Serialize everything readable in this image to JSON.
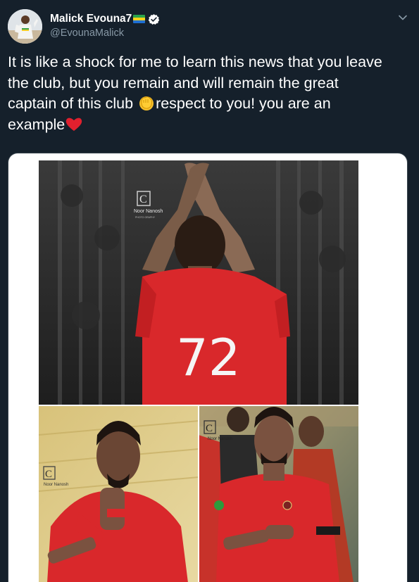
{
  "user": {
    "display_name": "Malick Evouna7",
    "handle": "@EvounaMalick",
    "verified": true,
    "flag_icon": "gabon-flag-icon"
  },
  "tweet": {
    "lines": [
      "It is like a shock for me to learn this news that you leave",
      "the club, but you remain and will remain the great",
      "captain of this club ",
      "respect to you! you are an",
      "example"
    ],
    "emoji_fist": "raised-fist-emoji",
    "emoji_heart": "red-heart-emoji"
  },
  "media": {
    "jersey_number": "72",
    "watermark_brand": "Noor Nanosh",
    "watermark_sub": "PHOTO GRAPHY"
  },
  "colors": {
    "background": "#15202b",
    "secondary_text": "#8899a6",
    "verified_blue": "#ffffff",
    "jersey_red": "#d9282b"
  }
}
